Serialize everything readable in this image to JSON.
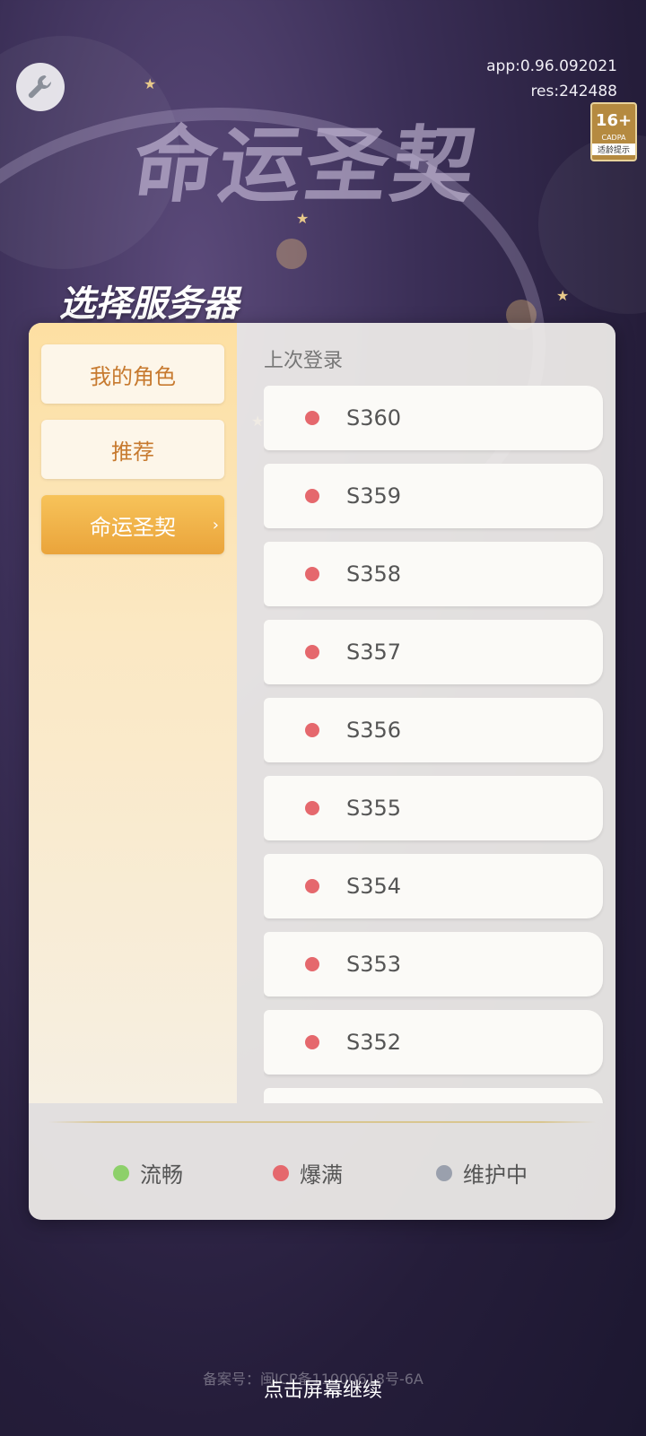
{
  "app_version": "app:0.96.092021",
  "res_version": "res:242488",
  "game_logo": "命运圣契",
  "age_rating": {
    "num": "16+",
    "sub": "CADPA",
    "tip": "适龄提示"
  },
  "panel_title": "选择服务器",
  "sidebar": {
    "items": [
      {
        "label": "我的角色"
      },
      {
        "label": "推荐"
      },
      {
        "label": "命运圣契"
      }
    ]
  },
  "list_header": "上次登录",
  "servers": [
    {
      "name": "S360",
      "status": "爆满"
    },
    {
      "name": "S359",
      "status": "爆满"
    },
    {
      "name": "S358",
      "status": "爆满"
    },
    {
      "name": "S357",
      "status": "爆满"
    },
    {
      "name": "S356",
      "status": "爆满"
    },
    {
      "name": "S355",
      "status": "爆满"
    },
    {
      "name": "S354",
      "status": "爆满"
    },
    {
      "name": "S353",
      "status": "爆满"
    },
    {
      "name": "S352",
      "status": "爆满"
    }
  ],
  "legend": {
    "smooth": {
      "label": "流畅",
      "color": "#8dd06a"
    },
    "full": {
      "label": "爆满",
      "color": "#e5686d"
    },
    "maintenance": {
      "label": "维护中",
      "color": "#9aa0ad"
    }
  },
  "icp": "备案号：闽ICP备11000618号-6A",
  "continue_hint": "点击屏幕继续"
}
